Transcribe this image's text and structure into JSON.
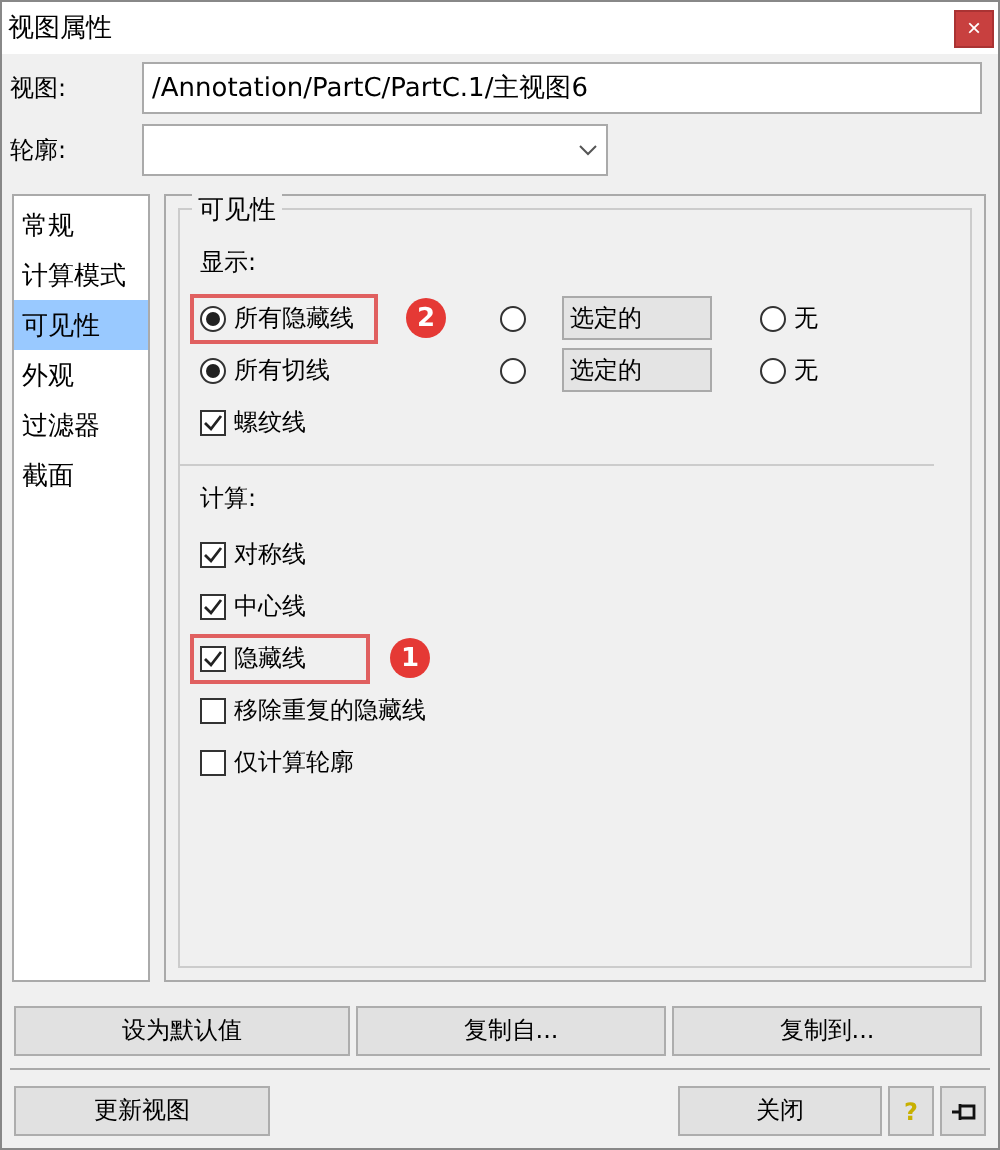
{
  "window": {
    "title": "视图属性",
    "close": "×"
  },
  "fields": [
    {
      "label": "视图:",
      "kind": "text",
      "value": "/Annotation/PartC/PartC.1/主视图6"
    },
    {
      "label": "轮廓:",
      "kind": "dropdown"
    }
  ],
  "sidebar": {
    "items": [
      {
        "label": "常规",
        "selected": false
      },
      {
        "label": "计算模式",
        "selected": false
      },
      {
        "label": "可见性",
        "selected": true
      },
      {
        "label": "外观",
        "selected": false
      },
      {
        "label": "过滤器",
        "selected": false
      },
      {
        "label": "截面",
        "selected": false
      }
    ]
  },
  "group": {
    "title": "可见性",
    "display": {
      "heading": "显示:",
      "rows": [
        {
          "options": [
            {
              "label": "所有隐藏线",
              "selected": true,
              "kind": "radio"
            },
            {
              "label": "选定的",
              "selected": false,
              "kind": "radio-field"
            },
            {
              "label": "无",
              "selected": false,
              "kind": "radio"
            }
          ],
          "callout": "2"
        },
        {
          "options": [
            {
              "label": "所有切线",
              "selected": true,
              "kind": "radio"
            },
            {
              "label": "选定的",
              "selected": false,
              "kind": "radio-field"
            },
            {
              "label": "无",
              "selected": false,
              "kind": "radio"
            }
          ]
        }
      ],
      "checks": [
        {
          "label": "螺纹线",
          "checked": true
        }
      ]
    },
    "compute": {
      "heading": "计算:",
      "checks": [
        {
          "label": "对称线",
          "checked": true
        },
        {
          "label": "中心线",
          "checked": true
        },
        {
          "label": "隐藏线",
          "checked": true,
          "callout": "1"
        },
        {
          "label": "移除重复的隐藏线",
          "checked": false
        },
        {
          "label": "仅计算轮廓",
          "checked": false
        }
      ]
    }
  },
  "buttons_row": [
    "设为默认值",
    "复制自...",
    "复制到..."
  ],
  "footer": {
    "update": "更新视图",
    "close": "关闭",
    "help": "?"
  }
}
